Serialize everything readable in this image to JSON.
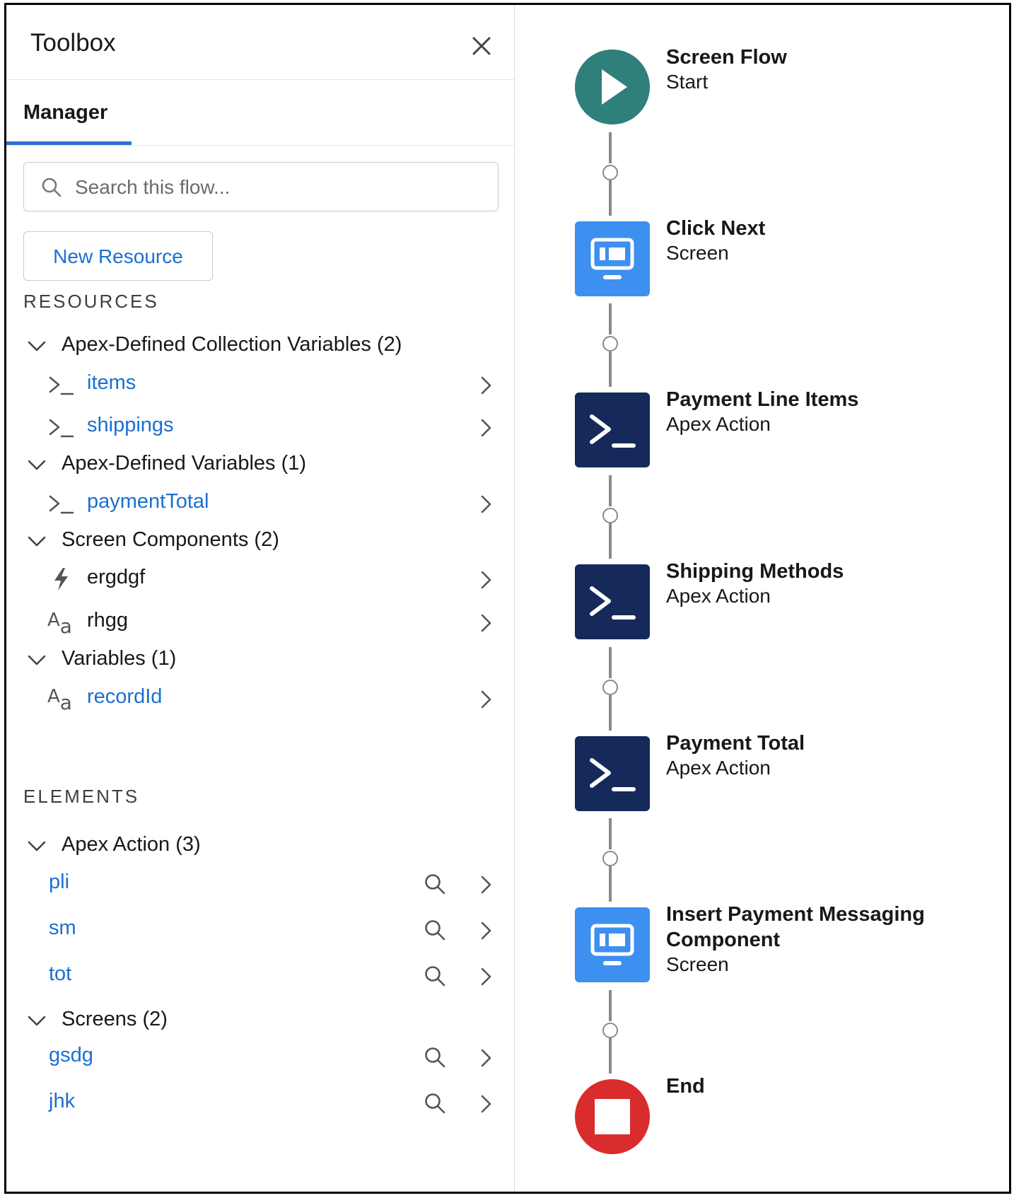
{
  "toolbox": {
    "title": "Toolbox",
    "close_icon": "close-icon",
    "tab_label": "Manager",
    "search_placeholder": "Search this flow...",
    "new_resource_label": "New Resource",
    "resources_heading": "RESOURCES",
    "elements_heading": "ELEMENTS",
    "resource_groups": [
      {
        "label": "Apex-Defined Collection Variables (2)",
        "items": [
          {
            "label": "items",
            "icon": "apex-variable-icon"
          },
          {
            "label": "shippings",
            "icon": "apex-variable-icon"
          }
        ]
      },
      {
        "label": "Apex-Defined Variables (1)",
        "items": [
          {
            "label": "paymentTotal",
            "icon": "apex-variable-icon"
          }
        ]
      },
      {
        "label": "Screen Components (2)",
        "items": [
          {
            "label": "ergdgf",
            "icon": "lightning-bolt-icon"
          },
          {
            "label": "rhgg",
            "icon": "text-aa-icon"
          }
        ]
      },
      {
        "label": "Variables (1)",
        "items": [
          {
            "label": "recordId",
            "icon": "text-aa-icon"
          }
        ]
      }
    ],
    "element_groups": [
      {
        "label": "Apex Action (3)",
        "items": [
          "pli",
          "sm",
          "tot"
        ]
      },
      {
        "label": "Screens (2)",
        "items": [
          "gsdg",
          "jhk"
        ]
      }
    ]
  },
  "flow": {
    "colors": {
      "start": "#2f7f7a",
      "screen": "#3d8ff0",
      "apex": "#15295a",
      "end": "#d92c2c",
      "connector": "#8a8a8a",
      "link": "#1b6fd1"
    },
    "nodes": [
      {
        "title": "Screen Flow",
        "type": "Start",
        "icon": "play-icon"
      },
      {
        "title": "Click Next",
        "type": "Screen",
        "icon": "screen-icon"
      },
      {
        "title": "Payment Line Items",
        "type": "Apex Action",
        "icon": "apex-icon"
      },
      {
        "title": "Shipping Methods",
        "type": "Apex Action",
        "icon": "apex-icon"
      },
      {
        "title": "Payment Total",
        "type": "Apex Action",
        "icon": "apex-icon"
      },
      {
        "title": "Insert Payment Messaging Component",
        "type": "Screen",
        "icon": "screen-icon"
      },
      {
        "title": "End",
        "type": "",
        "icon": "stop-icon"
      }
    ]
  }
}
